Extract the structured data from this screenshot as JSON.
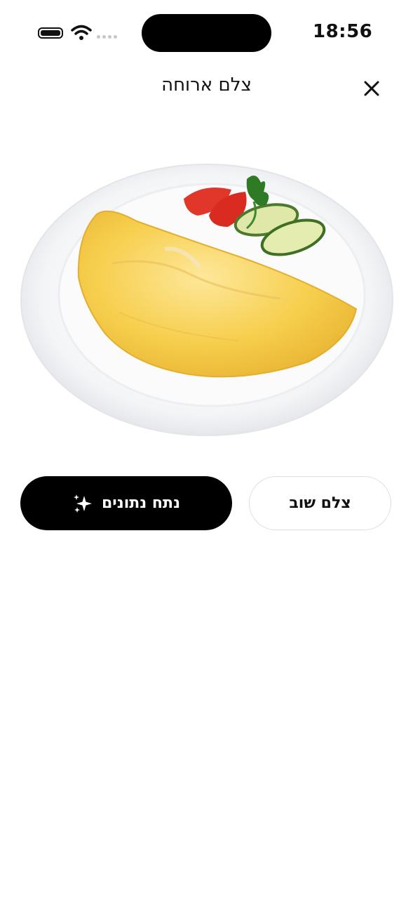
{
  "status_bar": {
    "time": "18:56",
    "battery_icon": "battery-icon",
    "wifi_icon": "wifi-icon",
    "signal_icon": "cellular-signal-icon"
  },
  "header": {
    "title": "צלם ארוחה",
    "close_icon": "close-icon"
  },
  "photo": {
    "subject": "omelette-plate-image"
  },
  "actions": {
    "analyze_label": "נתח נתונים",
    "analyze_icon": "sparkles-icon",
    "retake_label": "צלם שוב"
  },
  "colors": {
    "primary_button_bg": "#000000",
    "primary_button_text": "#ffffff",
    "secondary_button_border": "#dedede"
  }
}
